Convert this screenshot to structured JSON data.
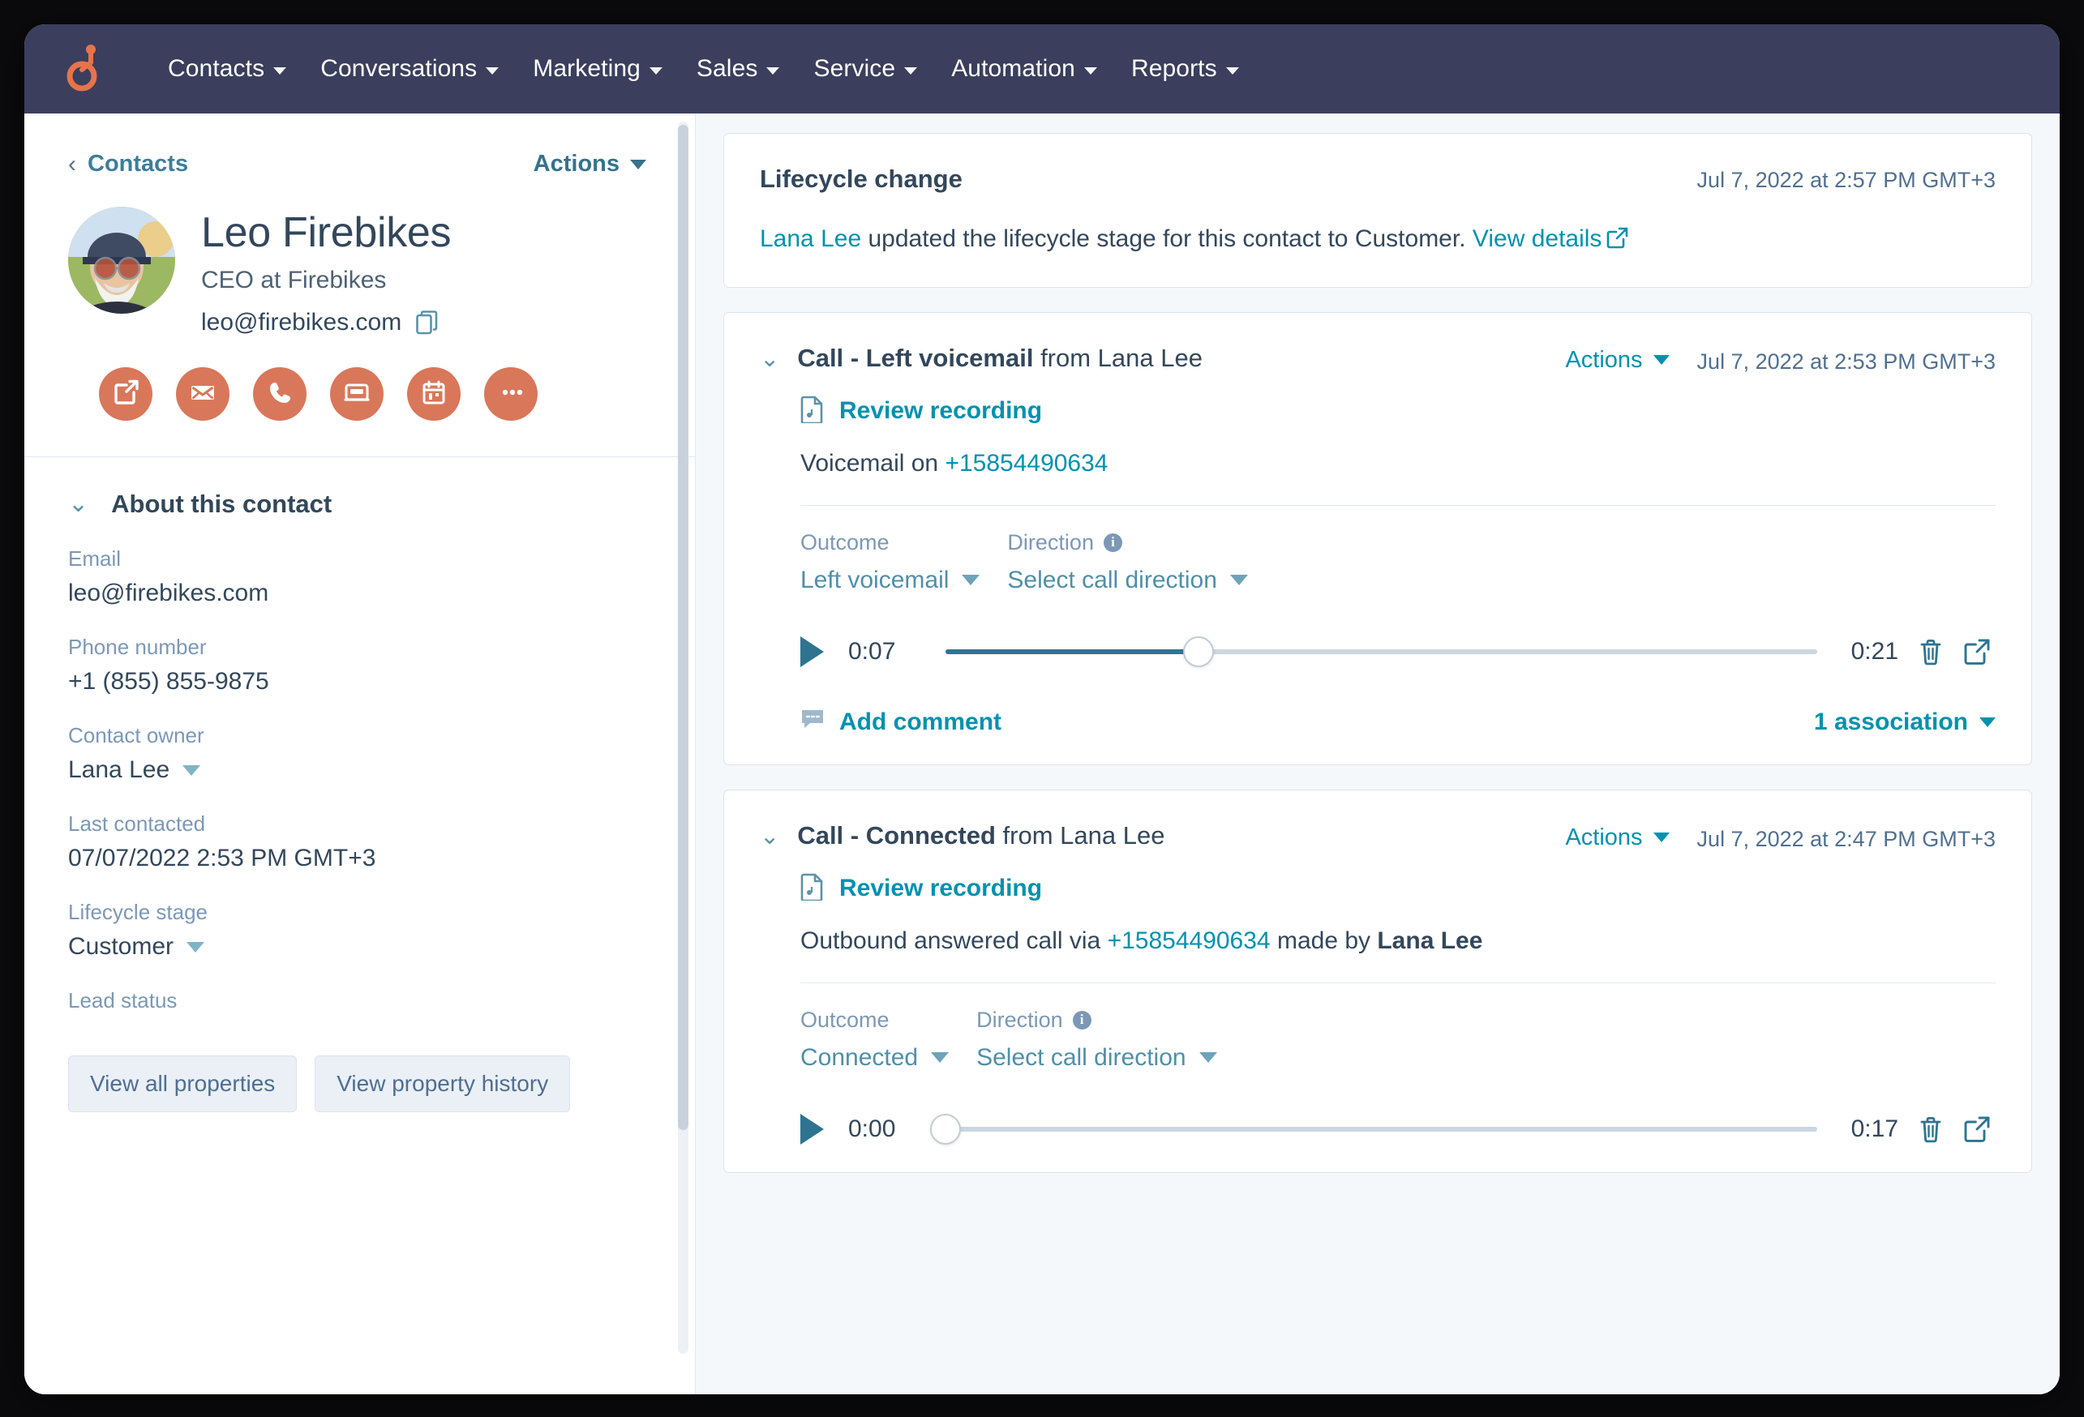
{
  "nav": {
    "logo_name": "hubspot-logo",
    "items": [
      {
        "label": "Contacts"
      },
      {
        "label": "Conversations"
      },
      {
        "label": "Marketing"
      },
      {
        "label": "Sales"
      },
      {
        "label": "Service"
      },
      {
        "label": "Automation"
      },
      {
        "label": "Reports"
      }
    ]
  },
  "sidebar": {
    "breadcrumb": "Contacts",
    "actions_label": "Actions",
    "contact": {
      "name": "Leo Firebikes",
      "role": "CEO at Firebikes",
      "email": "leo@firebikes.com"
    },
    "quick_actions": [
      {
        "name": "note-icon"
      },
      {
        "name": "email-icon"
      },
      {
        "name": "call-icon"
      },
      {
        "name": "log-icon"
      },
      {
        "name": "calendar-icon"
      },
      {
        "name": "more-icon"
      }
    ],
    "about_title": "About this contact",
    "properties": [
      {
        "label": "Email",
        "value": "leo@firebikes.com",
        "dropdown": false
      },
      {
        "label": "Phone number",
        "value": "+1 (855) 855-9875",
        "dropdown": false
      },
      {
        "label": "Contact owner",
        "value": "Lana Lee",
        "dropdown": true
      },
      {
        "label": "Last contacted",
        "value": "07/07/2022 2:53 PM GMT+3",
        "dropdown": false
      },
      {
        "label": "Lifecycle stage",
        "value": "Customer",
        "dropdown": true
      },
      {
        "label": "Lead status",
        "value": "",
        "dropdown": false
      }
    ],
    "buttons": {
      "view_all_properties": "View all properties",
      "view_property_history": "View property history"
    }
  },
  "timeline": {
    "lifecycle_card": {
      "title": "Lifecycle change",
      "timestamp": "Jul 7, 2022 at 2:57 PM GMT+3",
      "actor": "Lana Lee",
      "body": " updated the lifecycle stage for this contact to Customer. ",
      "view_details": "View details"
    },
    "calls": [
      {
        "title_bold": "Call - Left voicemail",
        "title_rest": " from Lana Lee",
        "actions_label": "Actions",
        "timestamp": "Jul 7, 2022 at 2:53 PM GMT+3",
        "review_recording": "Review recording",
        "desc_prefix": "Voicemail on ",
        "desc_phone": "+15854490634",
        "desc_mid": "",
        "desc_author": "",
        "outcome_label": "Outcome",
        "outcome_value": "Left voicemail",
        "direction_label": "Direction",
        "direction_value": "Select call direction",
        "player": {
          "current_time": "0:07",
          "total_time": "0:21",
          "progress_percent": 29
        },
        "add_comment": "Add comment",
        "association": "1 association"
      },
      {
        "title_bold": "Call - Connected",
        "title_rest": " from Lana Lee",
        "actions_label": "Actions",
        "timestamp": "Jul 7, 2022 at 2:47 PM GMT+3",
        "review_recording": "Review recording",
        "desc_prefix": "Outbound answered call via ",
        "desc_phone": "+15854490634",
        "desc_mid": " made by ",
        "desc_author": "Lana Lee",
        "outcome_label": "Outcome",
        "outcome_value": "Connected",
        "direction_label": "Direction",
        "direction_value": "Select call direction",
        "player": {
          "current_time": "0:00",
          "total_time": "0:17",
          "progress_percent": 0
        },
        "add_comment": "",
        "association": ""
      }
    ]
  },
  "colors": {
    "nav_bg": "#3b3e5c",
    "brand_orange": "#d9775a",
    "link_teal": "#0091ae",
    "text_dark": "#33475b",
    "label_muted": "#7c98b6",
    "page_bg": "#f5f8fa"
  }
}
